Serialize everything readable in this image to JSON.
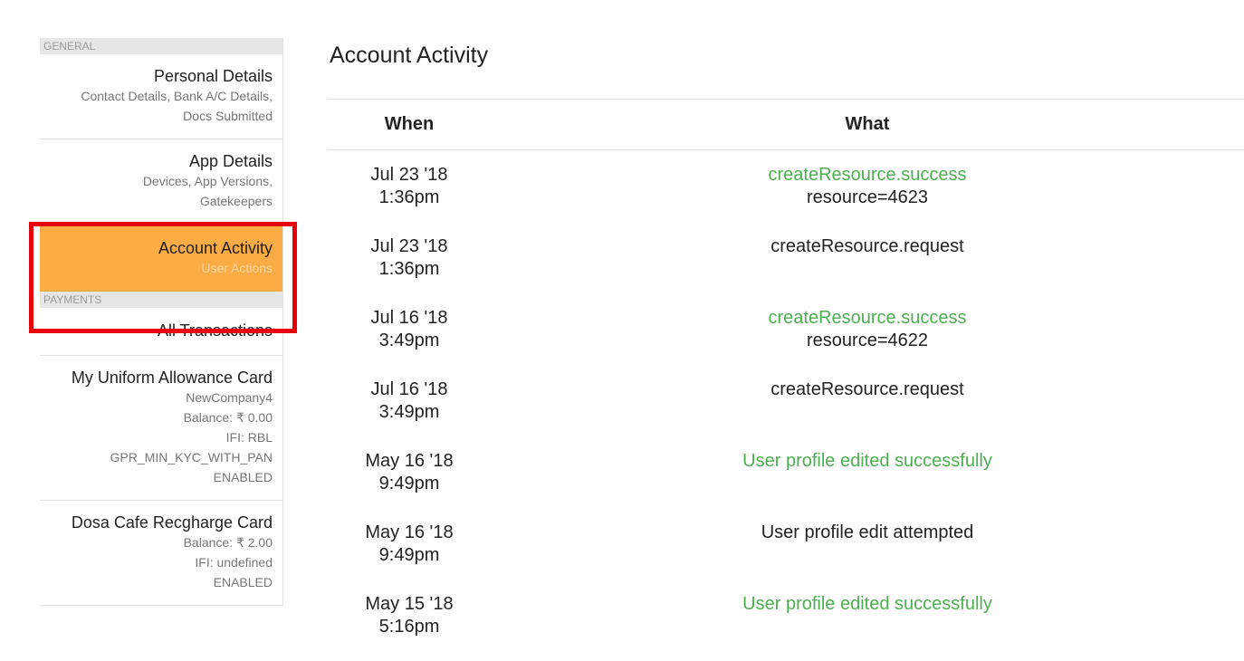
{
  "sidebar": {
    "sections": {
      "general": "GENERAL",
      "payments": "PAYMENTS"
    },
    "items": [
      {
        "title": "Personal Details",
        "sub": [
          "Contact Details, Bank A/C Details,",
          "Docs Submitted"
        ]
      },
      {
        "title": "App Details",
        "sub": [
          "Devices, App Versions,",
          "Gatekeepers"
        ]
      },
      {
        "title": "Account Activity",
        "sub": [
          "User Actions"
        ]
      },
      {
        "title": "All Transactions",
        "sub": []
      },
      {
        "title": "My Uniform Allowance Card",
        "sub": [
          "NewCompany4",
          "Balance: ₹ 0.00",
          "IFI: RBL",
          "GPR_MIN_KYC_WITH_PAN",
          "ENABLED"
        ]
      },
      {
        "title": "Dosa Cafe Recgharge Card",
        "sub": [
          "Balance: ₹ 2.00",
          "IFI: undefined",
          "ENABLED"
        ]
      }
    ]
  },
  "main": {
    "title": "Account Activity",
    "columns": {
      "when": "When",
      "what": "What"
    },
    "rows": [
      {
        "date": "Jul 23 '18",
        "time": "1:36pm",
        "event": "createResource.success",
        "detail": "resource=4623"
      },
      {
        "date": "Jul 23 '18",
        "time": "1:36pm",
        "event": "createResource.request",
        "detail": ""
      },
      {
        "date": "Jul 16 '18",
        "time": "3:49pm",
        "event": "createResource.success",
        "detail": "resource=4622"
      },
      {
        "date": "Jul 16 '18",
        "time": "3:49pm",
        "event": "createResource.request",
        "detail": ""
      },
      {
        "date": "May 16 '18",
        "time": "9:49pm",
        "event": "User profile edited successfully",
        "detail": ""
      },
      {
        "date": "May 16 '18",
        "time": "9:49pm",
        "event": "User profile edit attempted",
        "detail": ""
      },
      {
        "date": "May 15 '18",
        "time": "5:16pm",
        "event": "User profile edited successfully",
        "detail": ""
      }
    ]
  },
  "colors": {
    "active_item_bg": "#fbac44",
    "success_text": "#4caf50",
    "highlight_border": "#e8000b"
  }
}
